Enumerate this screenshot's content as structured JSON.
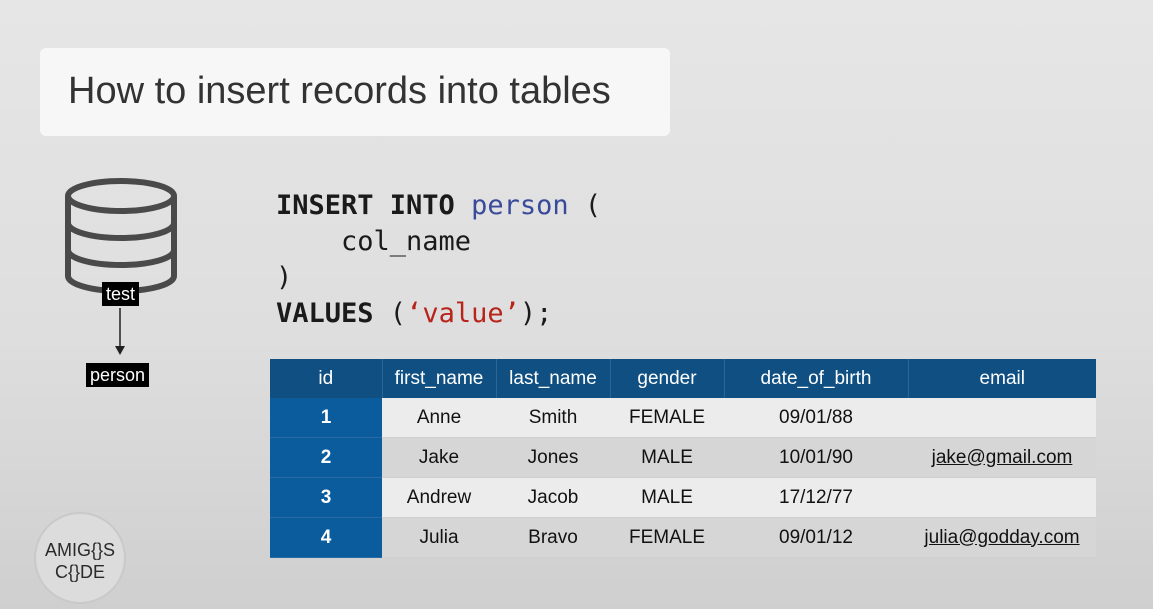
{
  "slide": {
    "title": "How to insert records into tables"
  },
  "diagram": {
    "database_label": "test",
    "table_label": "person"
  },
  "code": {
    "line1_kw": "INSERT INTO",
    "line1_ident": "person",
    "line1_paren": " (",
    "line2": "    col_name",
    "line3": ")",
    "line4_kw": "VALUES",
    "line4_open": " (",
    "line4_str": "‘value’",
    "line4_close": ");"
  },
  "table": {
    "columns": [
      "id",
      "first_name",
      "last_name",
      "gender",
      "date_of_birth",
      "email"
    ],
    "rows": [
      {
        "id": "1",
        "first_name": "Anne",
        "last_name": "Smith",
        "gender": "FEMALE",
        "date_of_birth": "09/01/88",
        "email": ""
      },
      {
        "id": "2",
        "first_name": "Jake",
        "last_name": "Jones",
        "gender": "MALE",
        "date_of_birth": "10/01/90",
        "email": "jake@gmail.com"
      },
      {
        "id": "3",
        "first_name": "Andrew",
        "last_name": "Jacob",
        "gender": "MALE",
        "date_of_birth": "17/12/77",
        "email": ""
      },
      {
        "id": "4",
        "first_name": "Julia",
        "last_name": "Bravo",
        "gender": "FEMALE",
        "date_of_birth": "09/01/12",
        "email": "julia@godday.com"
      }
    ]
  },
  "logo": {
    "line1": "AMIG{}S",
    "line2": "C{}DE"
  },
  "colors": {
    "header_blue": "#0f4f82",
    "id_cell_blue": "#0b5c9c",
    "keyword_ident_blue": "#3a4a9a",
    "string_red": "#b8231a"
  }
}
